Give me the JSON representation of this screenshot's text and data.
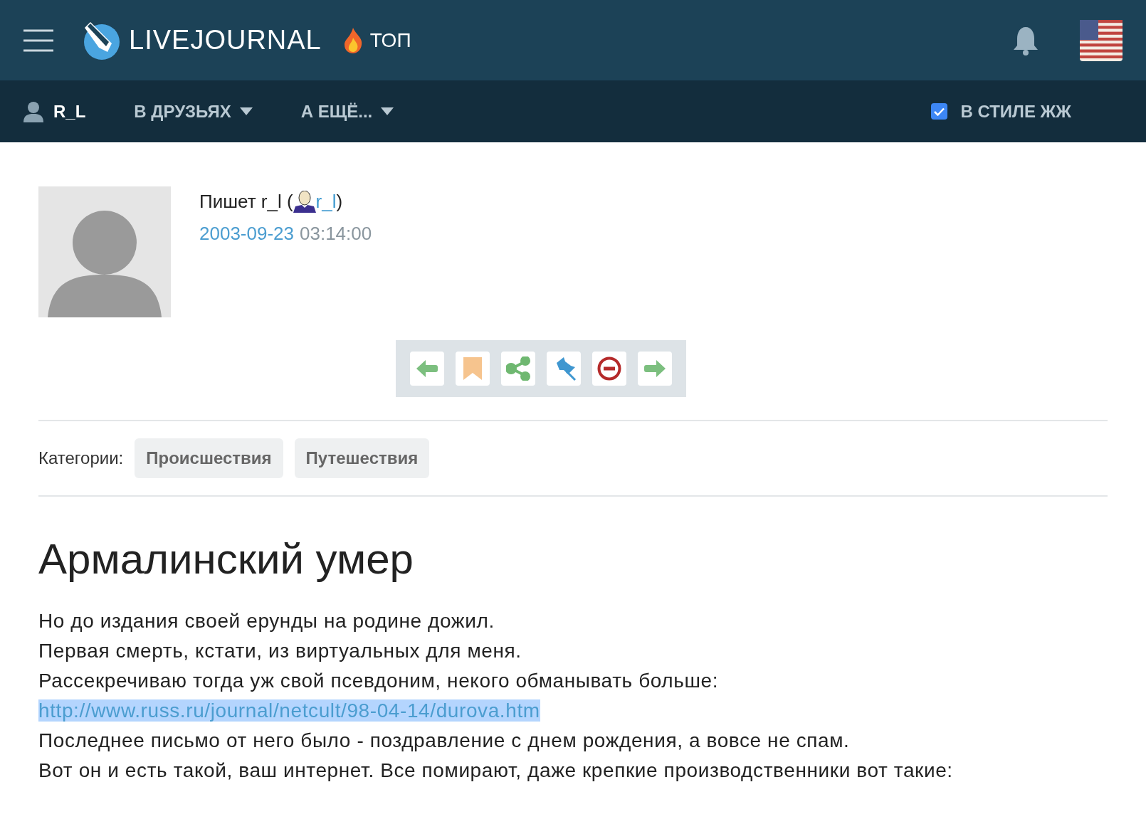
{
  "header": {
    "logo_text": "LIVEJOURNAL",
    "top_link": "ТОП"
  },
  "nav": {
    "user": "R_L",
    "menus": [
      {
        "label": "В ДРУЗЬЯХ"
      },
      {
        "label": "А ЕЩЁ..."
      }
    ],
    "style_toggle": {
      "label": "В СТИЛЕ ЖЖ",
      "checked": true
    }
  },
  "post": {
    "author_prefix": "Пишет r_l (",
    "author_link": "r_l",
    "author_suffix": ")",
    "date": "2003-09-23",
    "time": "03:14:00",
    "actions": [
      {
        "kind": "prev"
      },
      {
        "kind": "bookmark"
      },
      {
        "kind": "share"
      },
      {
        "kind": "pin"
      },
      {
        "kind": "block"
      },
      {
        "kind": "next"
      }
    ],
    "categories_label": "Категории:",
    "categories": [
      "Происшествия",
      "Путешествия"
    ],
    "title": "Армалинский умер",
    "lines": [
      {
        "kind": "text",
        "text": "Но до издания своей ерунды на родине дожил."
      },
      {
        "kind": "text",
        "text": "Первая смерть, кстати, из виртуальных для меня."
      },
      {
        "kind": "text",
        "text": "Рассекречиваю тогда уж свой псевдоним, некого обманывать больше:"
      },
      {
        "kind": "link",
        "text": "http://www.russ.ru/journal/netcult/98-04-14/durova.htm",
        "highlighted": true
      },
      {
        "kind": "text",
        "text": "Последнее письмо от него было - поздравление с днем рождения, а вовсе не спам."
      },
      {
        "kind": "text",
        "text": "Вот он и есть такой, ваш интернет. Все помирают, даже крепкие производственники вот такие:"
      }
    ]
  }
}
